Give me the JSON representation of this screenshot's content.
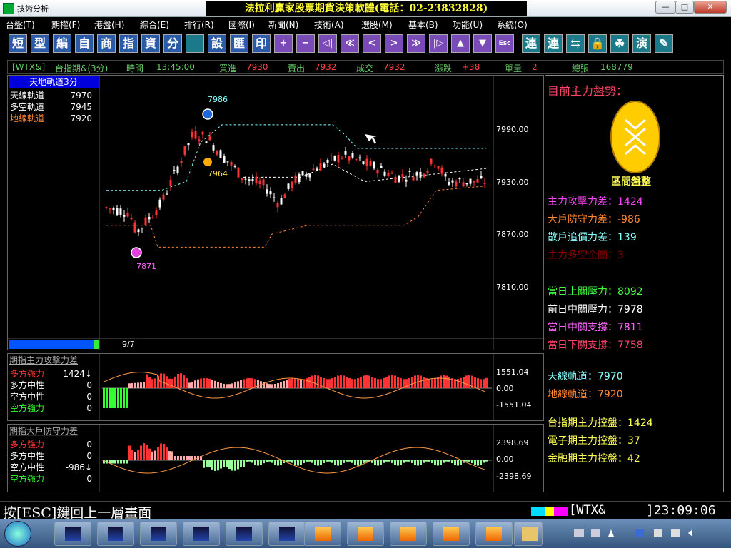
{
  "window": {
    "app_title": "技術分析",
    "brand_banner": "法拉利贏家股票期貨決策軟體(電話：02-23832828)",
    "minimize": "—",
    "maximize": "□",
    "close": "✕"
  },
  "menu": [
    "台盤(T)",
    "期權(F)",
    "港盤(H)",
    "綜合(E)",
    "排行(R)",
    "國際(I)",
    "新聞(N)",
    "技術(A)",
    "選股(M)",
    "基本(B)",
    "功能(U)",
    "系統(O)"
  ],
  "toolbar": {
    "text_buttons": [
      "短",
      "型",
      "編",
      "自",
      "商",
      "指",
      "資",
      "分"
    ],
    "text_buttons_2": [
      "設",
      "匯",
      "印"
    ],
    "arrow_buttons": [
      "+",
      "−",
      "◁|",
      "≪",
      "<",
      ">",
      "≫",
      "|▷",
      "▲",
      "▼",
      "Esc"
    ],
    "right_buttons": [
      "連",
      "連",
      "⇆",
      "🔒",
      "☘",
      "演",
      "✎"
    ]
  },
  "infobar": {
    "symbol": "[WTX&]",
    "name": "台指期&(3分)",
    "time_label": "時間",
    "time": "13:45:00",
    "bid_label": "買進",
    "bid": "7930",
    "ask_label": "賣出",
    "ask": "7932",
    "last_label": "成交",
    "last": "7932",
    "change_label": "漲跌",
    "change": "+38",
    "volume_label": "單量",
    "volume": "2",
    "total_label": "總張",
    "total": "168779"
  },
  "main_chart": {
    "title": "天地軌道3分",
    "legend": [
      {
        "label": "天線軌道",
        "value": "7970",
        "color": "#ffffff"
      },
      {
        "label": "多空軌道",
        "value": "7945",
        "color": "#ffffff"
      },
      {
        "label": "地線軌道",
        "value": "7920",
        "color": "#ff8833"
      }
    ],
    "date_label": "9/7",
    "peak_label": "7986",
    "mid_label": "7964",
    "low_label": "7871",
    "y_ticks": [
      "7990.00",
      "7930.00",
      "7870.00",
      "7810.00"
    ]
  },
  "sub1": {
    "title": "期指主力攻擊力差",
    "legend": [
      {
        "label": "多方強力",
        "value": "1424↓",
        "color": "#ff3333"
      },
      {
        "label": "多方中性",
        "value": "0",
        "color": "#ffffff"
      },
      {
        "label": "空方中性",
        "value": "0",
        "color": "#ffffff"
      },
      {
        "label": "空方強力",
        "value": "0",
        "color": "#33ff33"
      }
    ],
    "y_ticks": [
      "1551.04",
      "0.00",
      "-1551.04"
    ]
  },
  "sub2": {
    "title": "期指大戶防守力差",
    "legend": [
      {
        "label": "多方強力",
        "value": "0",
        "color": "#ff3333"
      },
      {
        "label": "多方中性",
        "value": "0",
        "color": "#ffffff"
      },
      {
        "label": "空方中性",
        "value": "-986↓",
        "color": "#ffffff"
      },
      {
        "label": "空方強力",
        "value": "0",
        "color": "#33ff33"
      }
    ],
    "y_ticks": [
      "2398.69",
      "0.00",
      "-2398.69"
    ]
  },
  "right_panel": {
    "header": "目前主力盤勢：",
    "trend_caption": "區間盤整",
    "group1": [
      {
        "label": "主力攻擊力差：",
        "value": "1424",
        "color": "#ff44ff"
      },
      {
        "label": "大戶防守力差：",
        "value": "-986",
        "color": "#ff8833"
      },
      {
        "label": "散戶追價力差：",
        "value": "139",
        "color": "#88ffff"
      },
      {
        "label": "主力多空企圖：",
        "value": "3",
        "color": "#880000"
      }
    ],
    "group2": [
      {
        "label": "當日上關壓力：",
        "value": "8092",
        "color": "#44ff44"
      },
      {
        "label": "前日中關壓力：",
        "value": "7978",
        "color": "#ffffff"
      },
      {
        "label": "當日中關支撐：",
        "value": "7811",
        "color": "#ff66ff"
      },
      {
        "label": "當日下關支撐：",
        "value": "7758",
        "color": "#ff4466"
      }
    ],
    "group3": [
      {
        "label": "天線軌道：",
        "value": "7970",
        "color": "#88ffff"
      },
      {
        "label": "地線軌道：",
        "value": "7920",
        "color": "#ff8833"
      }
    ],
    "group4": [
      {
        "label": "台指期主力控盤：",
        "value": "1424",
        "color": "#ffff55"
      },
      {
        "label": "電子期主力控盤：",
        "value": "37",
        "color": "#ffff55"
      },
      {
        "label": "金融期主力控盤：",
        "value": "42",
        "color": "#ffff55"
      }
    ]
  },
  "statusbar": {
    "hint": "按[ESC]鍵回上一層畫面",
    "symbol": "[WTX&",
    "clock": "]23:09:06"
  }
}
